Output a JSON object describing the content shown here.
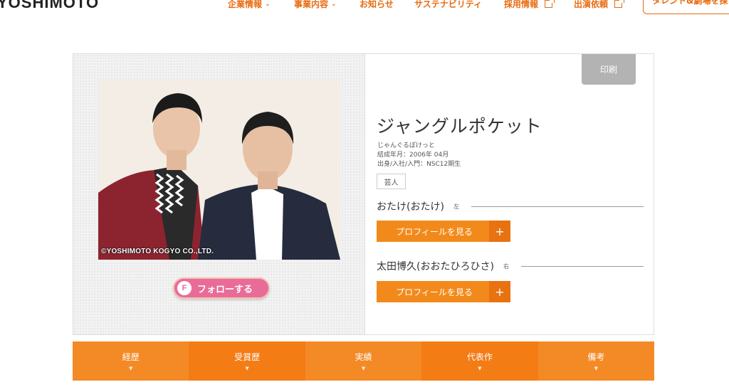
{
  "header": {
    "logo": "YOSHIMOTO",
    "nav": [
      {
        "label": "企業情報",
        "suffix": "⌄"
      },
      {
        "label": "事業内容",
        "suffix": "⌄"
      },
      {
        "label": "お知らせ",
        "suffix": ""
      },
      {
        "label": "サステナビリティ",
        "suffix": ""
      },
      {
        "label": "採用情報",
        "suffix": "ext"
      },
      {
        "label": "出演依頼",
        "suffix": "ext"
      }
    ],
    "talent_button": "タレント&劇場を探"
  },
  "profile": {
    "print_label": "印刷",
    "name": "ジャングルポケット",
    "kana": "じゃんぐるぽけっと",
    "formed": "結成年月：2006年 04月",
    "origin": "出身/入社/入門：NSC12期生",
    "tag": "芸人",
    "photo_copyright": "©YOSHIMOTO KOGYO CO.,LTD.",
    "follow_label": "フォローする",
    "follow_icon_letter": "F",
    "members": [
      {
        "name": "おたけ(おたけ)",
        "position": "左",
        "button": "プロフィールを見る",
        "plus": "+"
      },
      {
        "name": "太田博久(おおたひろひさ)",
        "position": "右",
        "button": "プロフィールを見る",
        "plus": "+"
      }
    ]
  },
  "tabs": [
    {
      "label": "経歴"
    },
    {
      "label": "受賞歴"
    },
    {
      "label": "実績"
    },
    {
      "label": "代表作"
    },
    {
      "label": "備考"
    }
  ],
  "colors": {
    "accent": "#f28a1b",
    "nav_text": "#e86a10",
    "follow_pink": "#e96b98",
    "print_gray": "#b3b3b3"
  },
  "icons": [
    "chevron-down-icon",
    "external-link-icon",
    "plus-icon",
    "follow-f-icon"
  ]
}
